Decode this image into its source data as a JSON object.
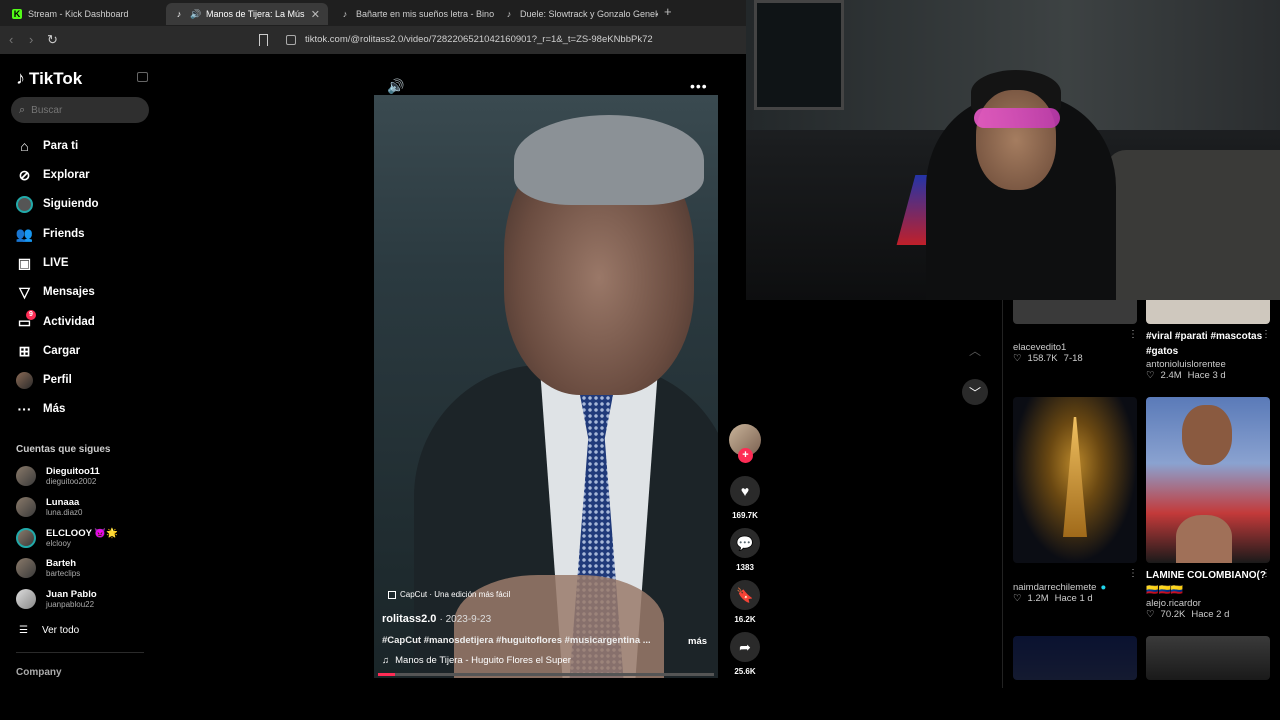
{
  "tabs": [
    {
      "label": "Stream - Kick Dashboard",
      "icon": "kick-icon",
      "color": "#53fc18"
    },
    {
      "label": "Manos de Tijera: La Música de",
      "icon": "tiktok-icon",
      "active": true
    },
    {
      "label": "Bañarte en mis sueños letra - Binomi",
      "icon": "tiktok-icon"
    },
    {
      "label": "Duele: Slowtrack y Gonzalo Genek c",
      "icon": "tiktok-icon"
    }
  ],
  "address": {
    "url": "tiktok.com/@rolitass2.0/video/7282206521042160901?_r=1&_t=ZS-98eKNbbPk72"
  },
  "sidebar": {
    "logo": "TikTok",
    "search_placeholder": "Buscar",
    "nav": [
      {
        "label": "Para ti",
        "icon": "home-icon"
      },
      {
        "label": "Explorar",
        "icon": "compass-icon"
      },
      {
        "label": "Siguiendo",
        "icon": "following-icon"
      },
      {
        "label": "Friends",
        "icon": "friends-icon"
      },
      {
        "label": "LIVE",
        "icon": "live-icon"
      },
      {
        "label": "Mensajes",
        "icon": "messages-icon"
      },
      {
        "label": "Actividad",
        "icon": "activity-icon",
        "badge": "9"
      },
      {
        "label": "Cargar",
        "icon": "upload-icon"
      },
      {
        "label": "Perfil",
        "icon": "profile-icon"
      },
      {
        "label": "Más",
        "icon": "more-icon"
      }
    ],
    "following_title": "Cuentas que sigues",
    "following": [
      {
        "name": "Dieguitoo11",
        "user": "dieguitoo2002"
      },
      {
        "name": "Lunaaa",
        "user": "luna.diaz0"
      },
      {
        "name": "ELCLOOY 👿🌟",
        "user": "elclooy"
      },
      {
        "name": "Barteh",
        "user": "barteclips"
      },
      {
        "name": "Juan Pablo",
        "user": "juanpablou22"
      }
    ],
    "see_all": "Ver todo",
    "company": "Company"
  },
  "video": {
    "capcut": "CapCut · Una edición más fácil",
    "username": "rolitass2.0",
    "date": "· 2023-9-23",
    "tags": "#CapCut #manosdetijera #huguitoflores #musicargentina ...",
    "more": "más",
    "music": "Manos de Tijera - Huguito Flores el Super",
    "progress": 0.05
  },
  "actions": {
    "likes": "169.7K",
    "comments": "1383",
    "saves": "16.2K",
    "shares": "25.6K"
  },
  "grid": [
    {
      "user": "elacevedito1",
      "views": "158.7K",
      "age": "7-18"
    },
    {
      "title": "#viral #parati #mascotas #gatos",
      "user": "antonioluislorentee",
      "views": "2.4M",
      "age": "Hace 3 d"
    },
    {
      "user": "naimdarrechilemete",
      "views": "1.2M",
      "age": "Hace 1 d",
      "verified": true
    },
    {
      "title": "LAMINE COLOMBIANO(?🇨🇴🇨🇴🇨🇴",
      "user": "alejo.ricardor",
      "views": "70.2K",
      "age": "Hace 2 d"
    }
  ]
}
